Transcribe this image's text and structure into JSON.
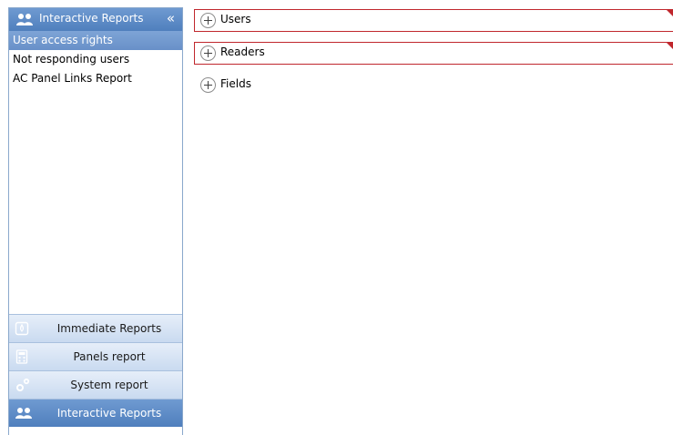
{
  "sidebar": {
    "header_title": "Interactive Reports",
    "collapse_glyph": "«",
    "items": [
      {
        "label": "User access rights",
        "active": true
      },
      {
        "label": "Not responding users",
        "active": false
      },
      {
        "label": "AC Panel Links Report",
        "active": false
      }
    ],
    "nav_buttons": [
      {
        "label": "Immediate Reports",
        "icon": "document-icon"
      },
      {
        "label": "Panels report",
        "icon": "calculator-icon"
      },
      {
        "label": "System report",
        "icon": "gears-icon"
      },
      {
        "label": "Interactive Reports",
        "icon": "users-icon",
        "active": true
      }
    ]
  },
  "main": {
    "groups": [
      {
        "label": "Users",
        "invalid": true
      },
      {
        "label": "Readers",
        "invalid": true
      },
      {
        "label": "Fields",
        "invalid": false
      }
    ]
  },
  "colors": {
    "header_blue": "#4f7fbd",
    "selection_blue": "#6890c8",
    "error_red": "#c0272d"
  }
}
